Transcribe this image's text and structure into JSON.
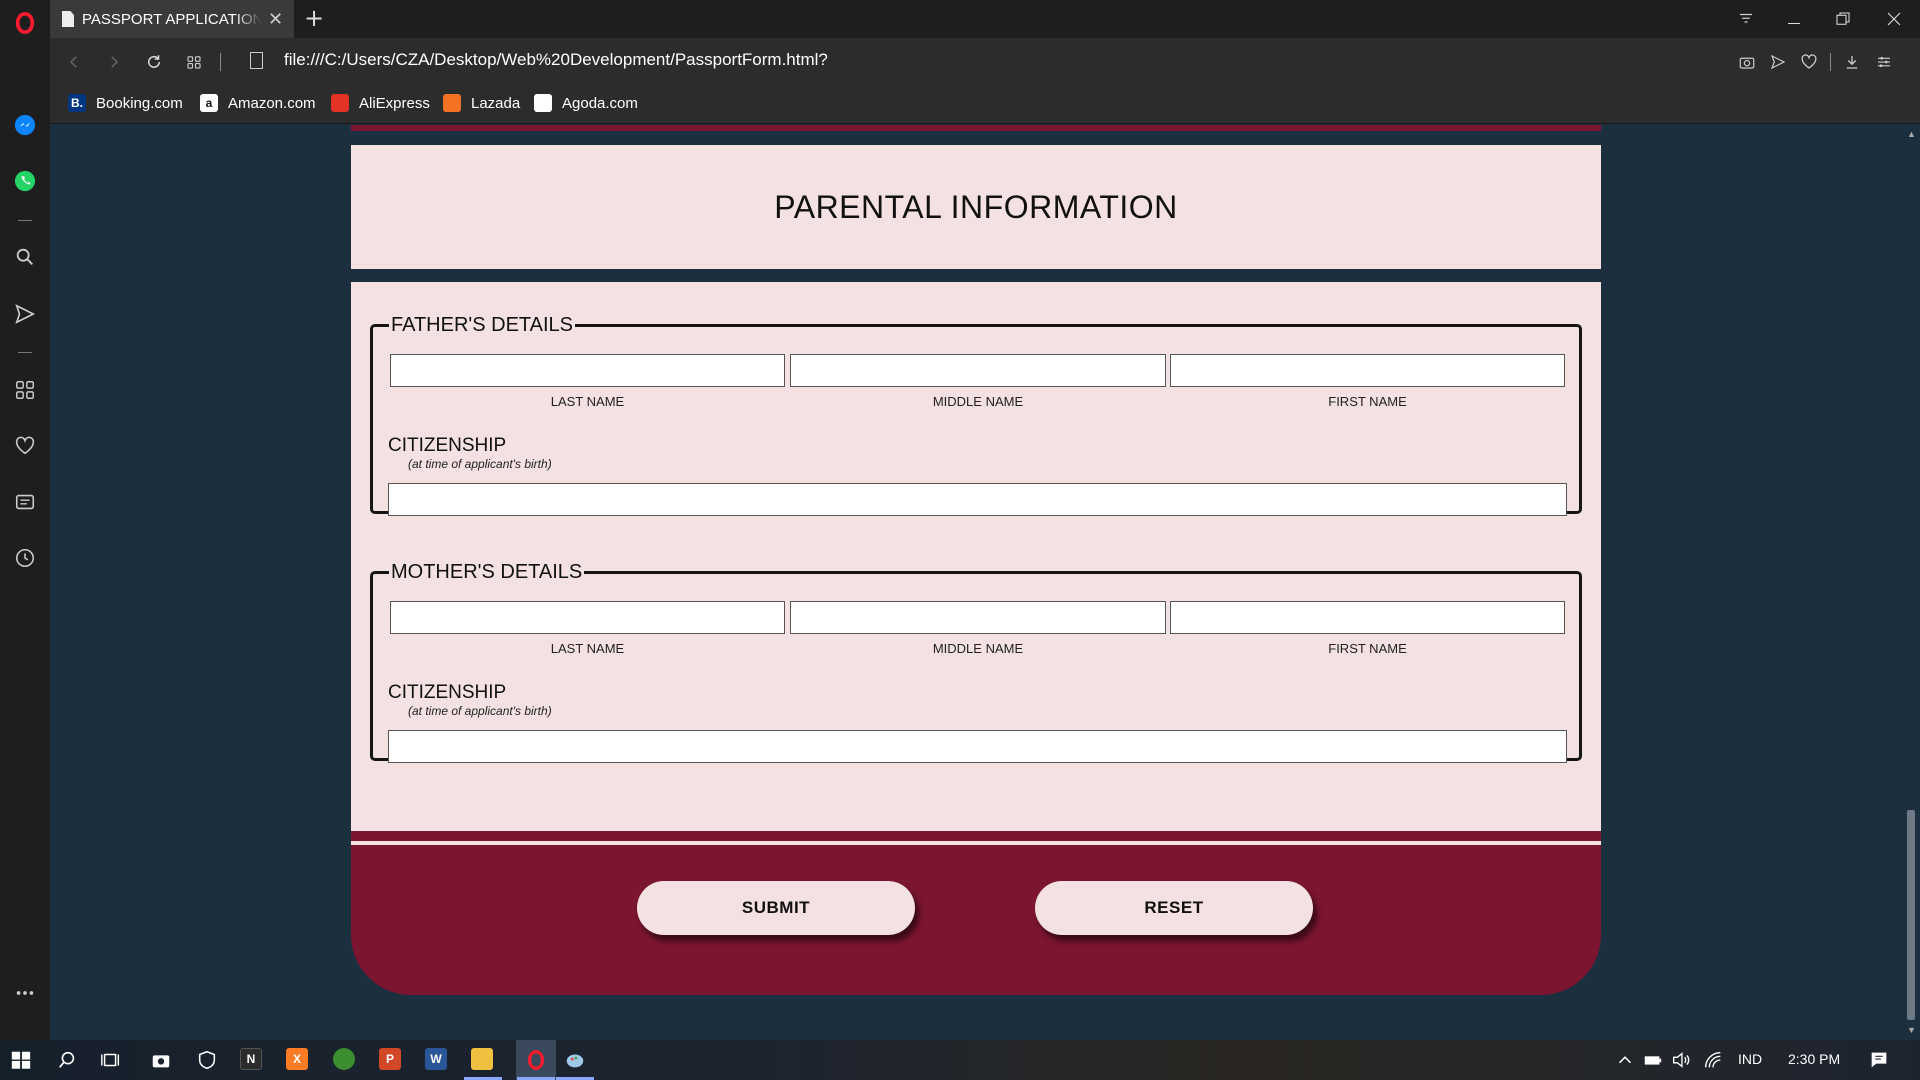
{
  "browser": {
    "tab_title": "PASSPORT APPLICATION FORM",
    "url": "file:///C:/Users/CZA/Desktop/Web%20Development/PassportForm.html?",
    "bookmarks": [
      {
        "label": "Booking.com",
        "icon": "booking-icon",
        "icon_text": "B.",
        "color": "#003580"
      },
      {
        "label": "Amazon.com",
        "icon": "amazon-icon",
        "icon_text": "a",
        "color": "#ffffff"
      },
      {
        "label": "AliExpress",
        "icon": "aliexpress-icon",
        "icon_text": "",
        "color": "#e43225"
      },
      {
        "label": "Lazada",
        "icon": "lazada-icon",
        "icon_text": "",
        "color": "#f57224"
      },
      {
        "label": "Agoda.com",
        "icon": "agoda-icon",
        "icon_text": "",
        "color": "#ffffff"
      }
    ]
  },
  "form": {
    "section_title": "PARENTAL INFORMATION",
    "father": {
      "legend": "FATHER'S DETAILS",
      "last_name_label": "LAST NAME",
      "middle_name_label": "MIDDLE NAME",
      "first_name_label": "FIRST NAME",
      "last_name_value": "",
      "middle_name_value": "",
      "first_name_value": "",
      "citizenship_label": "CITIZENSHIP",
      "citizenship_note": "(at time of applicant's birth)",
      "citizenship_value": ""
    },
    "mother": {
      "legend": "MOTHER'S DETAILS",
      "last_name_label": "LAST NAME",
      "middle_name_label": "MIDDLE NAME",
      "first_name_label": "FIRST NAME",
      "last_name_value": "",
      "middle_name_value": "",
      "first_name_value": "",
      "citizenship_label": "CITIZENSHIP",
      "citizenship_note": "(at time of applicant's birth)",
      "citizenship_value": ""
    },
    "submit_label": "SUBMIT",
    "reset_label": "RESET"
  },
  "taskbar": {
    "language": "IND",
    "time": "2:30 PM"
  },
  "colors": {
    "maroon": "#7b1530",
    "pink_panel": "#f4e1e2",
    "page_bg": "#1b2f3f",
    "opera_red": "#ff1b2d"
  }
}
